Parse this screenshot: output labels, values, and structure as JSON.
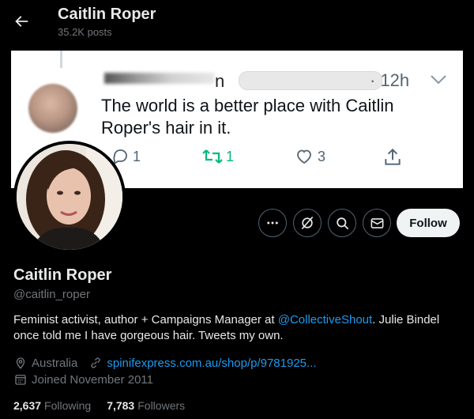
{
  "header": {
    "title": "Caitlin Roper",
    "posts_count": "35.2K posts"
  },
  "banner_tweet": {
    "handle_partial": "n",
    "time": "· 12h",
    "text": "The world is a better place with Caitlin Roper's hair in it.",
    "replies": "1",
    "retweets": "1",
    "likes": "3"
  },
  "actions": {
    "more_label": "More",
    "grok_label": "Grok",
    "search_label": "Search",
    "message_label": "Message",
    "follow_label": "Follow"
  },
  "profile": {
    "name": "Caitlin Roper",
    "handle": "@caitlin_roper",
    "bio_before": "Feminist activist, author + Campaigns Manager at ",
    "bio_mention": "@CollectiveShout",
    "bio_after": ". Julie Bindel once told me I have gorgeous hair. Tweets my own.",
    "location": "Australia",
    "website": "spinifexpress.com.au/shop/p/9781925...",
    "joined": "Joined November 2011",
    "following_count": "2,637",
    "following_label": "Following",
    "followers_count": "7,783",
    "followers_label": "Followers"
  },
  "colors": {
    "accent": "#1d9bf0",
    "retweet": "#00ba7c",
    "muted": "#71767b"
  }
}
